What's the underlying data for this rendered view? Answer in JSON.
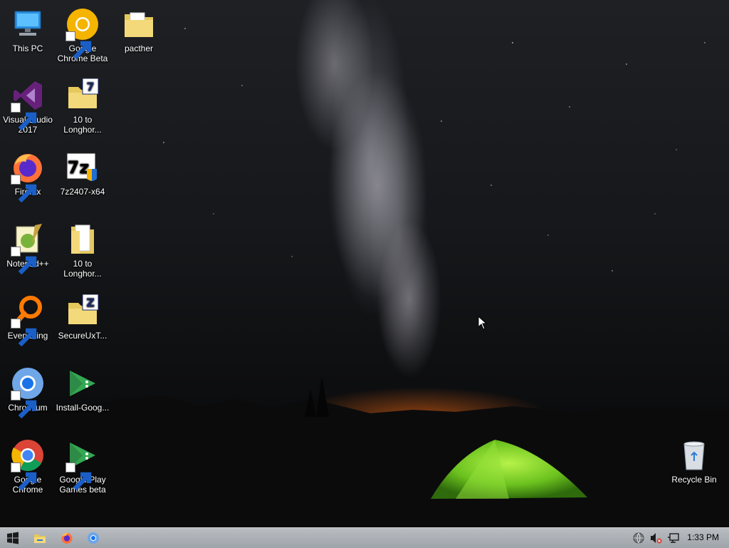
{
  "desktop": {
    "icons": [
      {
        "label": "This PC",
        "icon": "this-pc-icon"
      },
      {
        "label": "Google Chrome Beta",
        "icon": "chrome-beta-icon"
      },
      {
        "label": "pacther",
        "icon": "folder-icon"
      },
      {
        "label": "Visual Studio 2017",
        "icon": "visual-studio-icon"
      },
      {
        "label": "10 to Longhor...",
        "icon": "folder-7z-icon"
      },
      {
        "label": "Firefox",
        "icon": "firefox-icon"
      },
      {
        "label": "7z2407-x64",
        "icon": "7zip-installer-icon"
      },
      {
        "label": "Notepad++",
        "icon": "notepad-plus-plus-icon"
      },
      {
        "label": "10 to Longhor...",
        "icon": "folder-icon"
      },
      {
        "label": "Everything",
        "icon": "everything-search-icon"
      },
      {
        "label": "SecureUxT...",
        "icon": "folder-z-icon"
      },
      {
        "label": "Chromium",
        "icon": "chromium-icon"
      },
      {
        "label": "Install-Goog...",
        "icon": "google-play-games-icon"
      },
      {
        "label": "Google Chrome",
        "icon": "chrome-icon"
      },
      {
        "label": "Google Play Games beta",
        "icon": "google-play-games-icon"
      },
      {
        "label": "Recycle Bin",
        "icon": "recycle-bin-icon"
      }
    ]
  },
  "taskbar": {
    "start": {
      "icon": "windows-start-icon"
    },
    "pinned": [
      {
        "name": "File Explorer",
        "icon": "file-explorer-icon"
      },
      {
        "name": "Firefox",
        "icon": "firefox-icon"
      },
      {
        "name": "Chromium",
        "icon": "chromium-icon"
      }
    ],
    "tray": [
      {
        "icon": "network-globe-icon"
      },
      {
        "icon": "speaker-muted-icon"
      },
      {
        "icon": "network-monitor-icon"
      }
    ],
    "clock": "1:33 PM"
  },
  "colors": {
    "taskbar": "#a9adb2",
    "tent": "#7fd12a",
    "horizon_glow": "#ff6e14"
  }
}
